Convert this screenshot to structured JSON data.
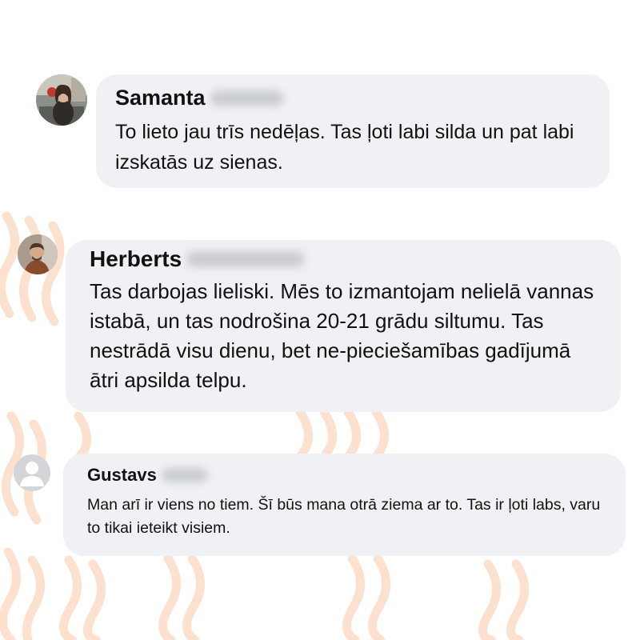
{
  "theme": {
    "bubble_color": "#f0f1f4",
    "decor_color": "#fde1cf",
    "text_color": "#111111",
    "placeholder_avatar_color": "#d3d5d9"
  },
  "comments": [
    {
      "author": "Samanta",
      "avatar": "profile-photo",
      "text": "To lieto jau trīs nedēļas. Tas ļoti labi silda un pat labi izskatās uz sienas."
    },
    {
      "author": "Herberts",
      "avatar": "profile-photo",
      "text": "Tas darbojas lieliski. Mēs to izmantojam nelielā vannas istabā, un tas nodrošina 20-21 grādu siltumu. Tas nestrādā visu dienu, bet ne-pieciešamības gadījumā ātri apsilda telpu."
    },
    {
      "author": "Gustavs",
      "avatar": "default-user-icon",
      "text": "Man arī ir viens no tiem. Šī būs mana otrā ziema ar to. Tas ir ļoti labs, varu to tikai ieteikt visiem."
    }
  ]
}
